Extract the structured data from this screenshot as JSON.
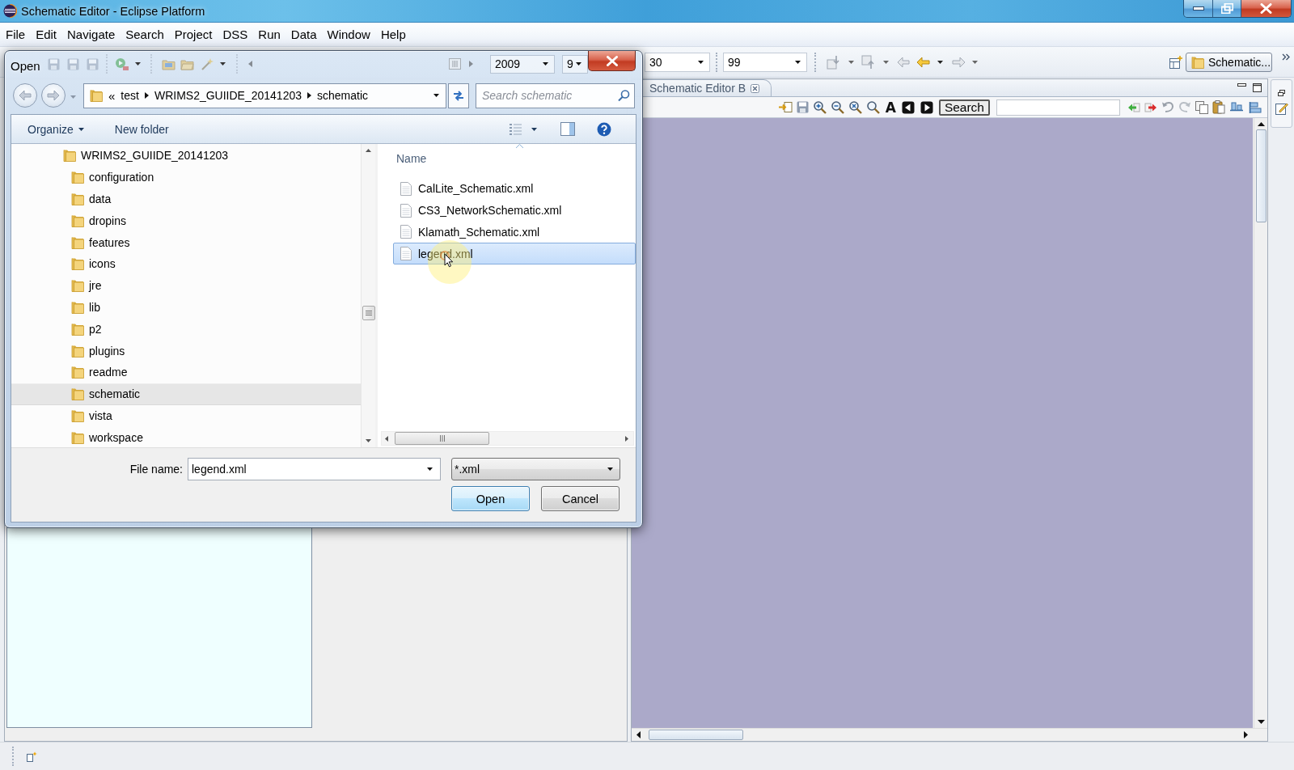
{
  "window": {
    "title": "Schematic Editor - Eclipse Platform"
  },
  "menu": [
    "File",
    "Edit",
    "Navigate",
    "Search",
    "Project",
    "DSS",
    "Run",
    "Data",
    "Window",
    "Help"
  ],
  "toolbar": {
    "combos": [
      {
        "value": "2009"
      },
      {
        "value": "9"
      },
      {
        "value": "30"
      },
      {
        "value": "99"
      }
    ],
    "perspective": "Schematic..."
  },
  "editor": {
    "tab": "Schematic Editor B",
    "font_button": "A",
    "search_button": "Search"
  },
  "dialog": {
    "title": "Open",
    "address": {
      "overflow": "«",
      "crumbs": [
        "test",
        "WRIMS2_GUIIDE_20141203",
        "schematic"
      ]
    },
    "search": {
      "placeholder": "Search schematic"
    },
    "commands": [
      {
        "label": "Organize",
        "dropdown": true
      },
      {
        "label": "New folder",
        "dropdown": false
      }
    ],
    "nav_tree": [
      {
        "label": "WRIMS2_GUIIDE_20141203",
        "selected": false,
        "children": [
          {
            "label": "configuration",
            "selected": false
          },
          {
            "label": "data",
            "selected": false
          },
          {
            "label": "dropins",
            "selected": false
          },
          {
            "label": "features",
            "selected": false
          },
          {
            "label": "icons",
            "selected": false
          },
          {
            "label": "jre",
            "selected": false
          },
          {
            "label": "lib",
            "selected": false
          },
          {
            "label": "p2",
            "selected": false
          },
          {
            "label": "plugins",
            "selected": false
          },
          {
            "label": "readme",
            "selected": false
          },
          {
            "label": "schematic",
            "selected": true
          },
          {
            "label": "vista",
            "selected": false
          },
          {
            "label": "workspace",
            "selected": false
          }
        ]
      }
    ],
    "files": {
      "column": "Name",
      "items": [
        {
          "name": "CalLite_Schematic.xml",
          "selected": false
        },
        {
          "name": "CS3_NetworkSchematic.xml",
          "selected": false
        },
        {
          "name": "Klamath_Schematic.xml",
          "selected": false
        },
        {
          "name": "legend.xml",
          "selected": true
        }
      ]
    },
    "file_name": {
      "label": "File name:",
      "value": "legend.xml"
    },
    "filter": {
      "value": "*.xml"
    },
    "buttons": [
      {
        "label": "Open",
        "kind": "default"
      },
      {
        "label": "Cancel",
        "kind": "normal"
      }
    ]
  }
}
